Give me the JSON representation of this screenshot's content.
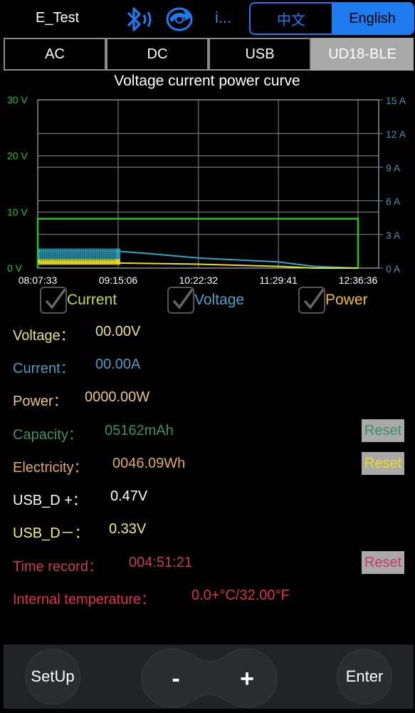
{
  "header": {
    "title": "E_Test",
    "more_label": "i...",
    "lang_zh": "中文",
    "lang_en": "English"
  },
  "tabs": [
    "AC",
    "DC",
    "USB",
    "UD18-BLE"
  ],
  "active_tab": "UD18-BLE",
  "chart_data": {
    "type": "line",
    "title": "Voltage current power curve",
    "x_ticks": [
      "08:07:33",
      "09:15:06",
      "10:22:32",
      "11:29:41",
      "12:36:36"
    ],
    "y_left_ticks": [
      "0 V",
      "10 V",
      "20 V",
      "30 V"
    ],
    "y_left_range": [
      0,
      30
    ],
    "y_right_ticks": [
      "0 A",
      "3 A",
      "6 A",
      "9 A",
      "12 A",
      "15 A"
    ],
    "y_right_range": [
      0,
      15
    ],
    "grid": true,
    "series": [
      {
        "name": "Voltage",
        "axis": "left",
        "color": "#22c42a",
        "points": [
          [
            "08:07:33",
            0
          ],
          [
            "08:07:33",
            8.8
          ],
          [
            "12:36:36",
            8.8
          ],
          [
            "12:36:36",
            0
          ]
        ]
      },
      {
        "name": "Current",
        "axis": "right",
        "color": "#2ea8c8",
        "points": [
          [
            "08:07:33",
            1.5
          ],
          [
            "09:15:06",
            1.5
          ],
          [
            "09:40:00",
            1.3
          ],
          [
            "10:22:32",
            0.9
          ],
          [
            "11:29:41",
            0.55
          ],
          [
            "12:00:00",
            0.15
          ],
          [
            "12:36:36",
            0.0
          ]
        ]
      },
      {
        "name": "Power",
        "axis": "left",
        "color": "#e8e020",
        "points": [
          [
            "08:07:33",
            1.2
          ],
          [
            "09:15:06",
            1.2
          ],
          [
            "09:15:06",
            0.9
          ],
          [
            "10:22:32",
            0.7
          ],
          [
            "11:29:41",
            0.3
          ],
          [
            "12:00:00",
            0.0
          ],
          [
            "12:36:36",
            0.0
          ]
        ]
      }
    ]
  },
  "checks": {
    "current": "Current",
    "voltage": "Voltage",
    "power": "Power"
  },
  "readings": {
    "voltage_label": "Voltage：",
    "voltage_value": "00.00V",
    "current_label": "Current：",
    "current_value": "00.00A",
    "power_label": "Power：",
    "power_value": "0000.00W",
    "capacity_label": "Capacity：",
    "capacity_value": "05162mAh",
    "electricity_label": "Electricity：",
    "electricity_value": "0046.09Wh",
    "usb_dp_label": "USB_D +：",
    "usb_dp_value": "0.47V",
    "usb_dm_label": "USB_D－：",
    "usb_dm_value": "0.33V",
    "time_label": "Time record：",
    "time_value": "004:51:21",
    "temp_label": "Internal temperature：",
    "temp_value": "0.0+°C/32.00°F"
  },
  "reset_label": "Reset",
  "bottom": {
    "setup": "SetUp",
    "minus": "-",
    "plus": "+",
    "enter": "Enter"
  },
  "colors": {
    "accent_blue": "#1e7cf0",
    "voltage": "#e6e08a",
    "current": "#4f9cc0",
    "power": "#e8c78a",
    "capacity": "#3e8f6a",
    "electricity": "#e2a860",
    "usb_dp": "#ffffff",
    "usb_dm": "#f2f07a",
    "time": "#c8386a",
    "temp": "#e0304a"
  }
}
